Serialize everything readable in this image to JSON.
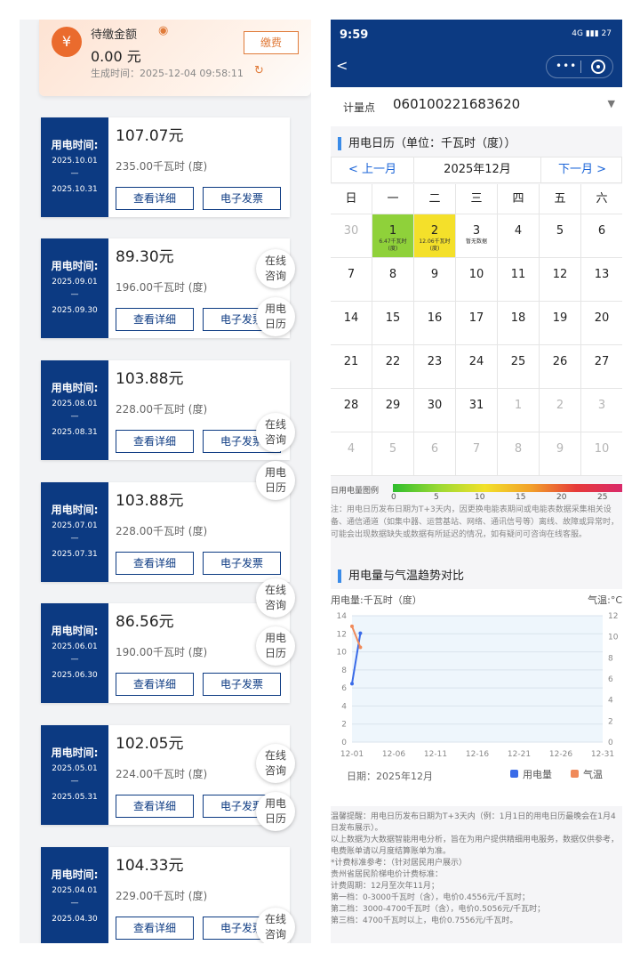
{
  "balance": {
    "label": "待缴金额",
    "amount": "0.00 元",
    "generated": "生成时间：2025-12-04 09:58:11",
    "pay_label": "缴费",
    "currency_icon": "¥"
  },
  "bill_common": {
    "period_label": "用电时间:",
    "dash": "—",
    "detail_label": "查看详细",
    "invoice_label": "电子发票"
  },
  "bills": [
    {
      "from": "2025.10.01",
      "to": "2025.10.31",
      "amount": "107.07元",
      "kwh": "235.00千瓦时 (度)"
    },
    {
      "from": "2025.09.01",
      "to": "2025.09.30",
      "amount": "89.30元",
      "kwh": "196.00千瓦时 (度)"
    },
    {
      "from": "2025.08.01",
      "to": "2025.08.31",
      "amount": "103.88元",
      "kwh": "228.00千瓦时 (度)"
    },
    {
      "from": "2025.07.01",
      "to": "2025.07.31",
      "amount": "103.88元",
      "kwh": "228.00千瓦时 (度)"
    },
    {
      "from": "2025.06.01",
      "to": "2025.06.30",
      "amount": "86.56元",
      "kwh": "190.00千瓦时 (度)"
    },
    {
      "from": "2025.05.01",
      "to": "2025.05.31",
      "amount": "102.05元",
      "kwh": "224.00千瓦时 (度)"
    },
    {
      "from": "2025.04.01",
      "to": "2025.04.30",
      "amount": "104.33元",
      "kwh": "229.00千瓦时 (度)"
    }
  ],
  "floating": {
    "consult_1": "在线",
    "consult_2": "咨询",
    "calendar_1": "用电",
    "calendar_2": "日历"
  },
  "status_bar": {
    "time": "9:59",
    "signal": "4G ▮▮▮ 27"
  },
  "meter": {
    "label": "计量点",
    "value": "060100221683620"
  },
  "calendar": {
    "title": "用电日历（单位：千瓦时（度））",
    "prev": "< 上一月",
    "month": "2025年12月",
    "next": "下一月 >",
    "weekdays": [
      "日",
      "一",
      "二",
      "三",
      "四",
      "五",
      "六"
    ],
    "rows": [
      [
        "30",
        "1",
        "2",
        "3",
        "4",
        "5",
        "6"
      ],
      [
        "7",
        "8",
        "9",
        "10",
        "11",
        "12",
        "13"
      ],
      [
        "14",
        "15",
        "16",
        "17",
        "18",
        "19",
        "20"
      ],
      [
        "21",
        "22",
        "23",
        "24",
        "25",
        "26",
        "27"
      ],
      [
        "28",
        "29",
        "30",
        "31",
        "1",
        "2",
        "3"
      ],
      [
        "4",
        "5",
        "6",
        "7",
        "8",
        "9",
        "10"
      ]
    ],
    "day1_sub1": "6.47千瓦时",
    "day1_sub2": "(度)",
    "day2_sub1": "12.06千瓦时",
    "day2_sub2": "(度)",
    "day3_sub": "暂无数据",
    "colors": {
      "day1": "#8fd13a",
      "day2": "#f4e02a"
    }
  },
  "legend": {
    "label": "日用电量图例",
    "ticks": [
      "0",
      "5",
      "10",
      "15",
      "20",
      "25"
    ]
  },
  "note": "注：用电日历发布日期为T+3天内，因更换电能表期间或电能表数据采集相关设备、通信通道（如集中器、运营基站、网络、通讯信号等）离线、故障或异常时，可能会出现数据缺失或数据有所延迟的情况，如有疑问可咨询在线客服。",
  "trend": {
    "title": "用电量与气温趋势对比",
    "unit_label": "用电量:千瓦时（度）",
    "temp_label": "气温:°C",
    "date_label": "日期：2025年12月",
    "legend_use": "用电量",
    "legend_temp": "气温"
  },
  "chart_data": {
    "type": "line",
    "x": [
      "12-01",
      "12-02"
    ],
    "x_ticks": [
      "12-01",
      "12-06",
      "12-11",
      "12-16",
      "12-21",
      "12-26",
      "12-31"
    ],
    "series": [
      {
        "name": "用电量",
        "values": [
          6.47,
          12.06
        ],
        "color": "#3a6be8",
        "axis": "left"
      },
      {
        "name": "气温",
        "values": [
          11,
          9
        ],
        "color": "#f08a5a",
        "axis": "right"
      }
    ],
    "ylim_left": [
      0,
      14
    ],
    "ylim_right": [
      0,
      12
    ],
    "yticks_left": [
      "0",
      "2",
      "4",
      "6",
      "8",
      "10",
      "12",
      "14"
    ],
    "yticks_right": [
      "0",
      "2",
      "4",
      "6",
      "8",
      "10",
      "12"
    ],
    "xlabel": "日期：2025年12月",
    "ylabel_left": "用电量:千瓦时（度）",
    "ylabel_right": "气温:°C",
    "legend": "bottom-right",
    "grid": true
  },
  "tips": [
    "温馨提醒：用电日历发布日期为T+3天内（例：1月1日的用电日历最晚会在1月4日发布展示）。",
    "以上数据为大数据智能用电分析，旨在为用户提供精细用电服务，数据仅供参考，电费账单请以月度结算账单为准。",
    "*计费标准参考：（针对居民用户展示）",
    "贵州省居民阶梯电价计费标准：",
    "计费周期：12月至次年11月；",
    "第一档：0-3000千瓦时（含），电价0.4556元/千瓦时；",
    "第二档：3000-4700千瓦时（含），电价0.5056元/千瓦时；",
    "第三档：4700千瓦时以上，电价0.7556元/千瓦时。"
  ]
}
